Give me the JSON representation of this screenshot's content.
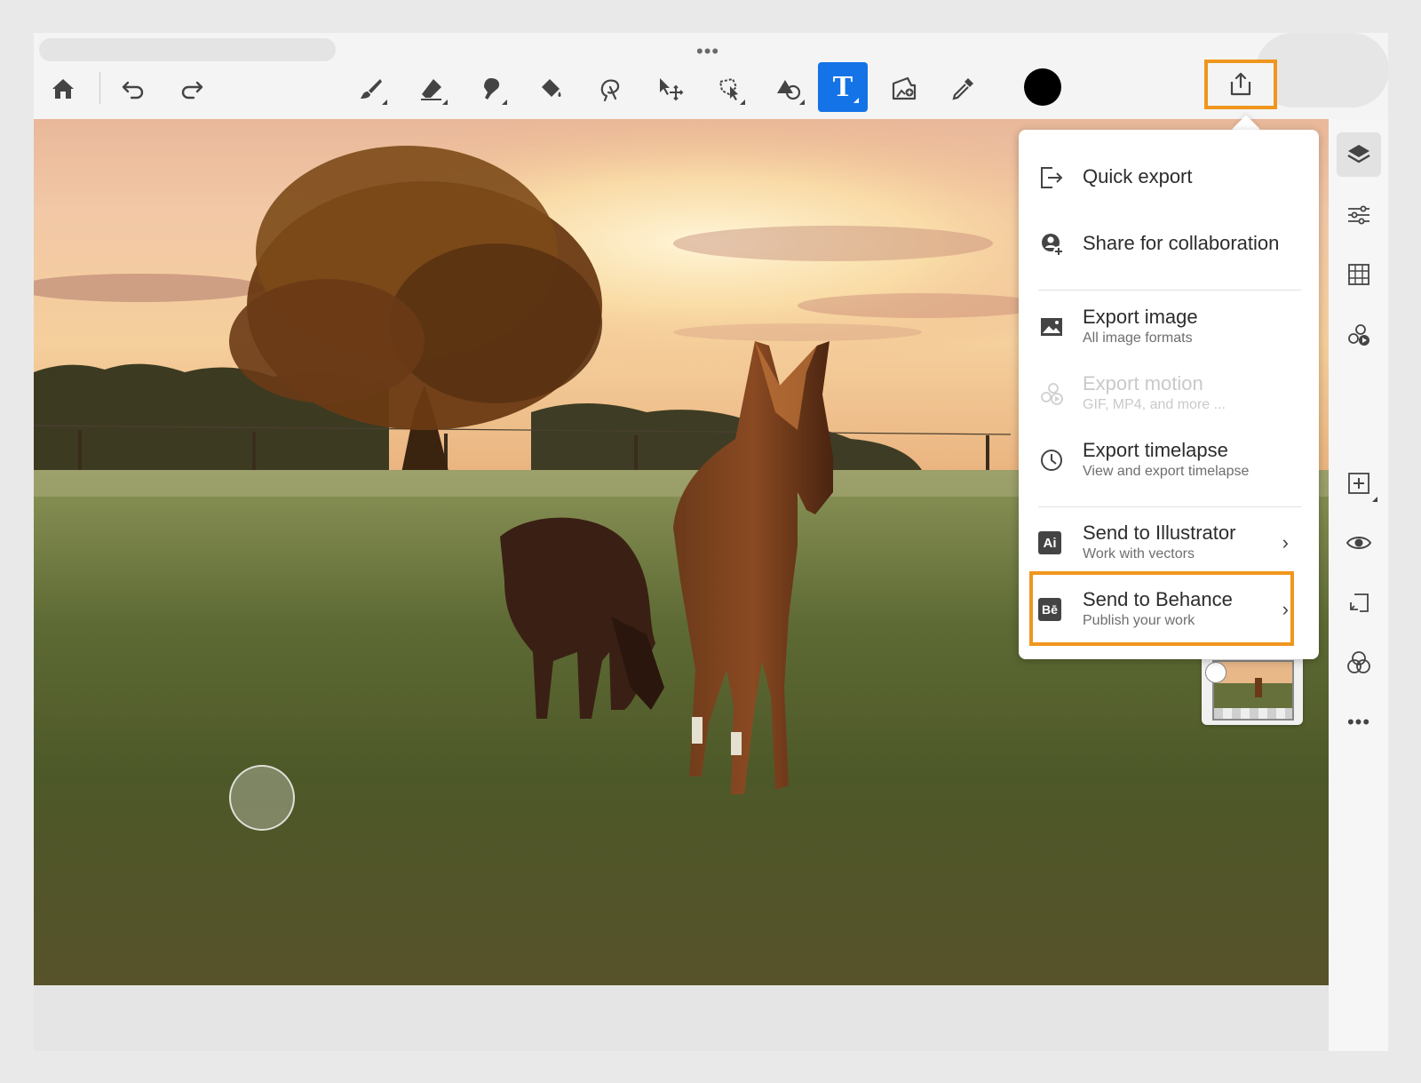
{
  "app": {
    "window_dots": "•••"
  },
  "toolbar": {
    "left": [
      {
        "name": "home-button",
        "icon": "home-icon"
      },
      {
        "name": "undo-button",
        "icon": "undo-icon"
      },
      {
        "name": "redo-button",
        "icon": "redo-icon"
      }
    ],
    "tools": [
      {
        "name": "brush-tool",
        "icon": "brush-icon"
      },
      {
        "name": "eraser-tool",
        "icon": "eraser-icon"
      },
      {
        "name": "smudge-tool",
        "icon": "smudge-icon"
      },
      {
        "name": "fill-tool",
        "icon": "paint-bucket-icon"
      },
      {
        "name": "lasso-tool",
        "icon": "lasso-icon"
      },
      {
        "name": "move-tool",
        "icon": "move-icon"
      },
      {
        "name": "selection-tool",
        "icon": "selection-icon"
      },
      {
        "name": "shape-tool",
        "icon": "shape-icon"
      },
      {
        "name": "text-tool",
        "icon": "text-icon",
        "label": "T",
        "active": true
      },
      {
        "name": "place-image-tool",
        "icon": "place-image-icon"
      },
      {
        "name": "eyedropper-tool",
        "icon": "eyedropper-icon"
      }
    ],
    "color_swatch": "#000000",
    "share_icon": "share-export-icon"
  },
  "export_menu": {
    "items": [
      {
        "name": "quick-export",
        "icon": "quick-export-icon",
        "label": "Quick export"
      },
      {
        "name": "share-for-collaboration",
        "icon": "collaboration-icon",
        "label": "Share for collaboration"
      },
      {
        "name": "export-image",
        "icon": "image-icon",
        "label": "Export image",
        "sub": "All image formats"
      },
      {
        "name": "export-motion",
        "icon": "motion-icon",
        "label": "Export motion",
        "sub": "GIF, MP4, and more ...",
        "disabled": true
      },
      {
        "name": "export-timelapse",
        "icon": "clock-icon",
        "label": "Export timelapse",
        "sub": "View and export timelapse"
      },
      {
        "name": "send-to-illustrator",
        "icon": "illustrator-icon",
        "label": "Send to Illustrator",
        "sub": "Work with vectors",
        "has_submenu": true
      },
      {
        "name": "send-to-behance",
        "icon": "behance-icon",
        "label": "Send to Behance",
        "sub": "Publish your work",
        "has_submenu": true,
        "highlighted": true
      }
    ],
    "illustrator_badge": "Ai",
    "behance_badge": "Bē",
    "chevron": "›"
  },
  "right_panel": {
    "items": [
      {
        "name": "layers-button",
        "icon": "layers-icon",
        "selected": true
      },
      {
        "name": "adjustments-button",
        "icon": "sliders-icon"
      },
      {
        "name": "grid-button",
        "icon": "grid-icon"
      },
      {
        "name": "motion-button",
        "icon": "motion-icon"
      },
      {
        "name": "add-layer-button",
        "icon": "add-layer-icon"
      },
      {
        "name": "visibility-button",
        "icon": "eye-icon"
      },
      {
        "name": "merge-down-button",
        "icon": "merge-down-icon"
      },
      {
        "name": "blend-mode-button",
        "icon": "blend-icon"
      },
      {
        "name": "more-button",
        "icon": "more-icon",
        "label": "•••"
      }
    ]
  },
  "colors": {
    "accent_blue": "#1473e6",
    "highlight_orange": "#f0961e"
  }
}
